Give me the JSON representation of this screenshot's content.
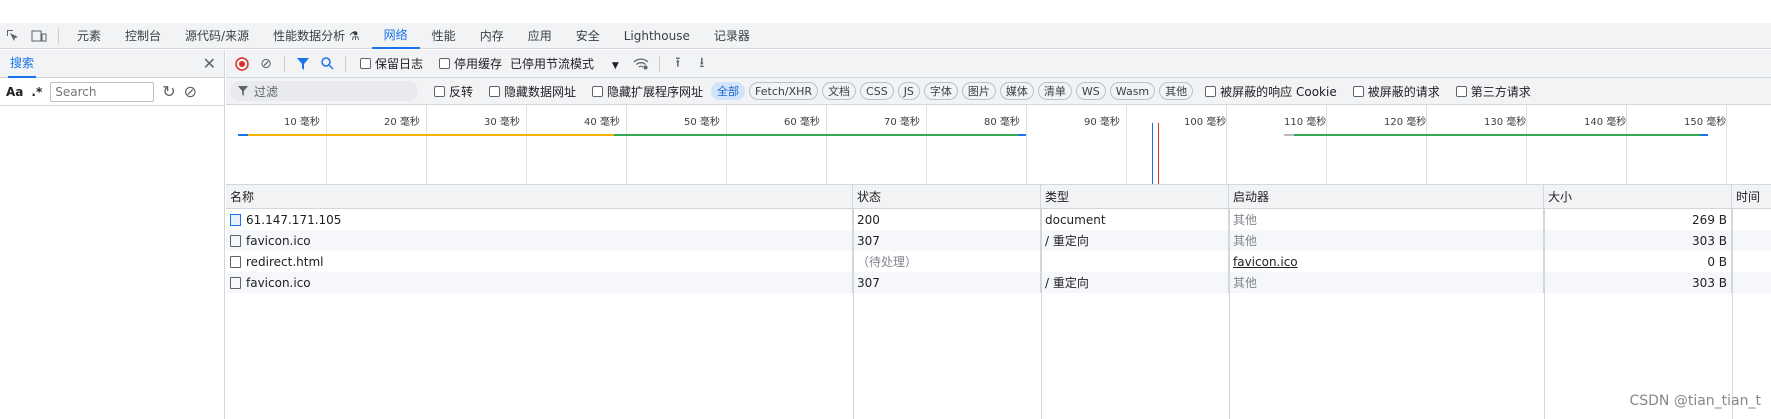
{
  "toolbar": {
    "tabs": [
      "元素",
      "控制台",
      "源代码/来源",
      "性能数据分析 ⚗",
      "网络",
      "性能",
      "内存",
      "应用",
      "安全",
      "Lighthouse",
      "记录器"
    ],
    "active_tab": "网络"
  },
  "search_panel": {
    "title": "搜索",
    "aa_label": "Aa",
    "regex_label": ".*",
    "search_placeholder": "Search"
  },
  "network_toolbar": {
    "preserve_log": "保留日志",
    "disable_cache": "停用缓存",
    "throttle": "已停用节流模式"
  },
  "filter_bar": {
    "filter_placeholder": "过滤",
    "invert": "反转",
    "hide_data_urls": "隐藏数据网址",
    "hide_ext_urls": "隐藏扩展程序网址",
    "chips": [
      "全部",
      "Fetch/XHR",
      "文档",
      "CSS",
      "JS",
      "字体",
      "图片",
      "媒体",
      "清单",
      "WS",
      "Wasm",
      "其他"
    ],
    "selected_chip": "全部",
    "blocked_cookies": "被屏蔽的响应 Cookie",
    "blocked_requests": "被屏蔽的请求",
    "third_party": "第三方请求"
  },
  "timeline": {
    "labels": [
      "10 毫秒",
      "20 毫秒",
      "30 毫秒",
      "40 毫秒",
      "50 毫秒",
      "60 毫秒",
      "70 毫秒",
      "80 毫秒",
      "90 毫秒",
      "100 毫秒",
      "110 毫秒",
      "120 毫秒",
      "130 毫秒",
      "140 毫秒",
      "150 毫秒"
    ],
    "colors": {
      "orange": "#f4b400",
      "green": "#34a853",
      "blue": "#1a73e8",
      "red": "#d93025"
    }
  },
  "table": {
    "headers": [
      "名称",
      "状态",
      "类型",
      "启动器",
      "大小",
      "时间"
    ],
    "rows": [
      {
        "name": "61.147.171.105",
        "status": "200",
        "type": "document",
        "initiator": "其他",
        "size": "269 B"
      },
      {
        "name": "favicon.ico",
        "status": "307",
        "type": "/ 重定向",
        "initiator": "其他",
        "size": "303 B"
      },
      {
        "name": "redirect.html",
        "status": "（待处理）",
        "type": "",
        "initiator": "favicon.ico",
        "size": "0 B"
      },
      {
        "name": "favicon.ico",
        "status": "307",
        "type": "/ 重定向",
        "initiator": "其他",
        "size": "303 B"
      }
    ]
  },
  "watermark": "CSDN @tian_tian_t"
}
